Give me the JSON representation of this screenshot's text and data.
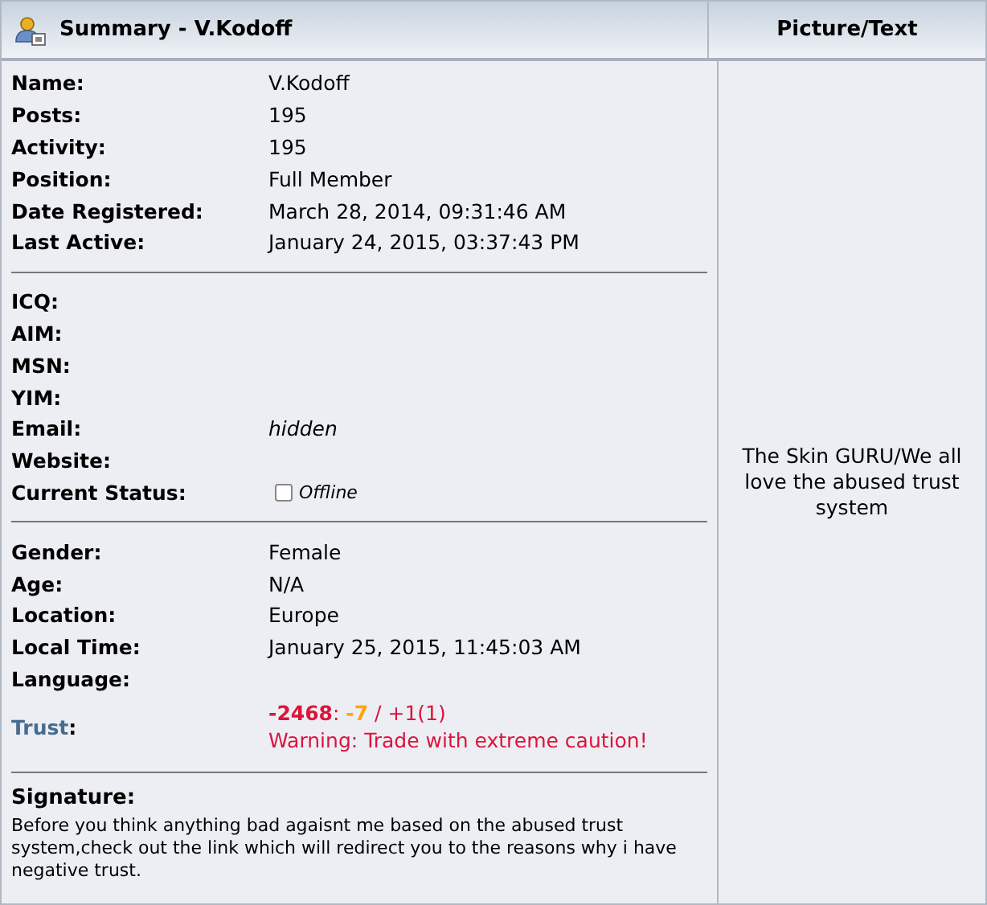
{
  "header": {
    "title": "Summary - V.Kodoff",
    "side_title": "Picture/Text"
  },
  "sections": [
    {
      "rows": [
        {
          "kind": "text",
          "label": "Name:",
          "value": "V.Kodoff"
        },
        {
          "kind": "text",
          "label": "Posts:",
          "value": "195"
        },
        {
          "kind": "text",
          "label": "Activity:",
          "value": "195"
        },
        {
          "kind": "text",
          "label": "Position:",
          "value": "Full Member"
        },
        {
          "kind": "text",
          "label": "Date Registered:",
          "value": "March 28, 2014, 09:31:46 AM"
        },
        {
          "kind": "text",
          "label": "Last Active:",
          "value": "January 24, 2015, 03:37:43 PM"
        }
      ]
    },
    {
      "rows": [
        {
          "kind": "text",
          "label": "ICQ:"
        },
        {
          "kind": "text",
          "label": "AIM:"
        },
        {
          "kind": "text",
          "label": "MSN:"
        },
        {
          "kind": "text",
          "label": "YIM:"
        },
        {
          "kind": "italic",
          "label": "Email:",
          "value": "hidden"
        },
        {
          "kind": "text",
          "label": "Website:"
        },
        {
          "kind": "status",
          "label": "Current Status:",
          "value": "Offline",
          "online": false
        }
      ]
    },
    {
      "rows": [
        {
          "kind": "text",
          "label": "Gender:",
          "value": "Female"
        },
        {
          "kind": "text",
          "label": "Age:",
          "value": "N/A"
        },
        {
          "kind": "text",
          "label": "Location:",
          "value": "Europe"
        },
        {
          "kind": "text",
          "label": "Local Time:",
          "value": "January 25, 2015, 11:45:03 AM"
        },
        {
          "kind": "text",
          "label": "Language:"
        },
        {
          "kind": "trust",
          "label": "Trust",
          "label_suffix": ":",
          "score": "-2468",
          "separator": ":",
          "recent": "-7",
          "rest": "/ +1(1)",
          "warning": "Warning: Trade with extreme caution!"
        }
      ]
    }
  ],
  "signature": {
    "label": "Signature:",
    "text": "Before you think anything bad agaisnt me based on the abused trust system,check out the link which will redirect you to the reasons why i have negative trust."
  },
  "personal_text": "The Skin GURU/We all love the abused trust system"
}
